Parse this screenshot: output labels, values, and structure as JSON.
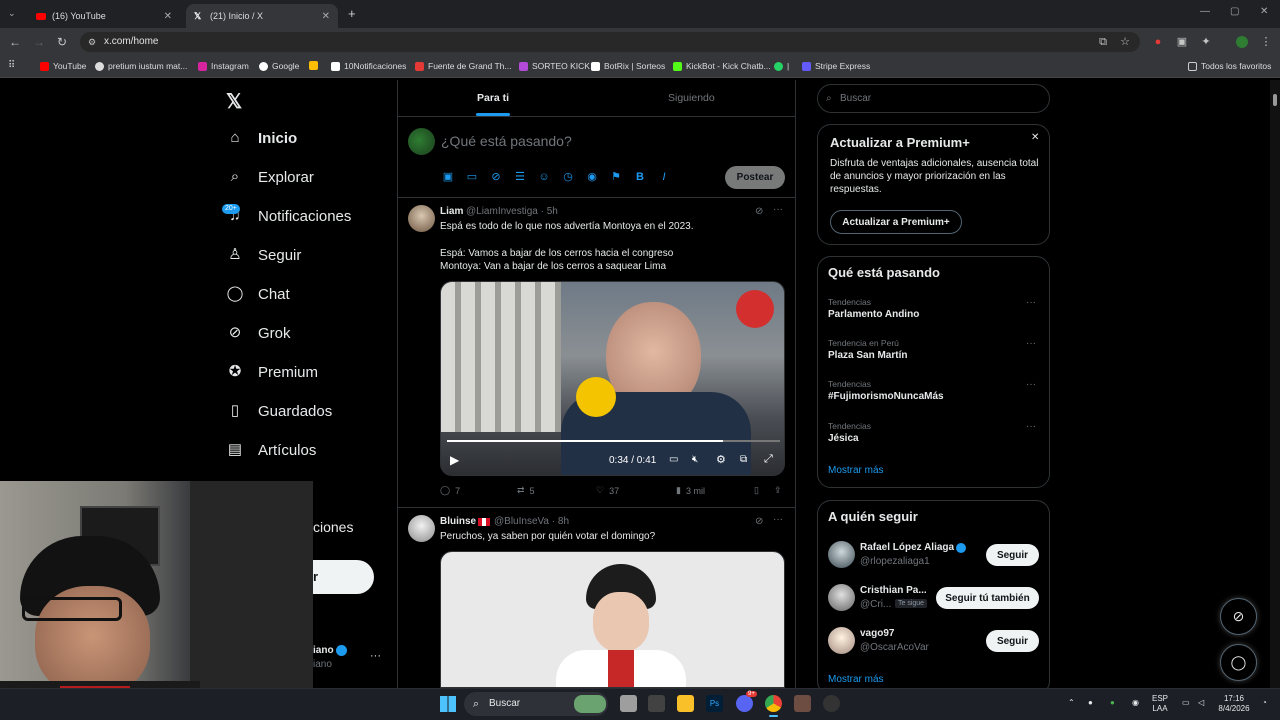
{
  "browser": {
    "tabs": [
      {
        "label": "(16) YouTube"
      },
      {
        "label": "(21) Inicio / X"
      }
    ],
    "url": "x.com/home",
    "bookmarks": [
      "YouTube",
      "pretium iustum mat...",
      "Instagram",
      "Google",
      "10Notificaciones",
      "Fuente de Grand Th...",
      "SORTEO KICK",
      "BotRix | Sorteos",
      "KickBot - Kick Chatb...",
      "|",
      "Stripe Express"
    ],
    "bookmarks_folder": "Todos los favoritos"
  },
  "nav": {
    "items": [
      {
        "label": "Inicio",
        "icon": "home-icon"
      },
      {
        "label": "Explorar",
        "icon": "search-icon"
      },
      {
        "label": "Notificaciones",
        "icon": "bell-icon"
      },
      {
        "label": "Seguir",
        "icon": "person-add-icon"
      },
      {
        "label": "Chat",
        "icon": "chat-icon"
      },
      {
        "label": "Grok",
        "icon": "grok-icon"
      },
      {
        "label": "Premium",
        "icon": "verified-icon"
      },
      {
        "label": "Guardados",
        "icon": "bookmark-icon"
      },
      {
        "label": "Artículos",
        "icon": "article-icon"
      }
    ],
    "notif_badge": "20+",
    "partial_more": "ciones",
    "partial_post": "r",
    "partial_account_name": "iano",
    "partial_account_handle": "iano"
  },
  "feed": {
    "tab_for_you": "Para ti",
    "tab_following": "Siguiendo",
    "compose_placeholder": "¿Qué está pasando?",
    "post_button": "Postear"
  },
  "tweets": [
    {
      "name": "Liam",
      "handle": "@LiamInvestiga",
      "time": "· 5h",
      "line1": "Espá es todo de lo que nos advertía Montoya en el 2023.",
      "line2": "Espá: Vamos a bajar de los cerros hacia el congreso",
      "line3": "Montoya: Van a bajar de los cerros a saquear Lima",
      "video_time": "0:34 / 0:41",
      "replies": "7",
      "reposts": "5",
      "likes": "37",
      "views": "3 mil"
    },
    {
      "name": "Bluinse",
      "handle": "@BluInseVa",
      "time": "· 8h",
      "line1": "Peruchos, ya saben por quién votar el domingo?"
    }
  ],
  "sidebar": {
    "search_placeholder": "Buscar",
    "premium": {
      "title": "Actualizar a Premium+",
      "desc": "Disfruta de ventajas adicionales, ausencia total de anuncios y mayor priorización en las respuestas.",
      "button": "Actualizar a Premium+"
    },
    "trends": {
      "title": "Qué está pasando",
      "items": [
        {
          "context": "Tendencias",
          "name": "Parlamento Andino"
        },
        {
          "context": "Tendencia en Perú",
          "name": "Plaza San Martín"
        },
        {
          "context": "Tendencias",
          "name": "#FujimorismoNuncaMás"
        },
        {
          "context": "Tendencias",
          "name": "Jésica"
        }
      ],
      "more": "Mostrar más"
    },
    "follow": {
      "title": "A quién seguir",
      "items": [
        {
          "name": "Rafael López Aliaga",
          "handle": "@rlopezaliaga1",
          "button": "Seguir"
        },
        {
          "name": "Cristhian Pa...",
          "handle": "@Cri...",
          "follows_you": "Te sigue",
          "button": "Seguir tú también"
        },
        {
          "name": "vago97",
          "handle": "@OscarAcoVar",
          "button": "Seguir"
        }
      ],
      "more": "Mostrar más"
    }
  },
  "taskbar": {
    "search": "Buscar",
    "lang_top": "ESP",
    "lang_bottom": "LAA",
    "time": "17:16",
    "date": "8/4/2026",
    "discord_badge": "9+"
  }
}
